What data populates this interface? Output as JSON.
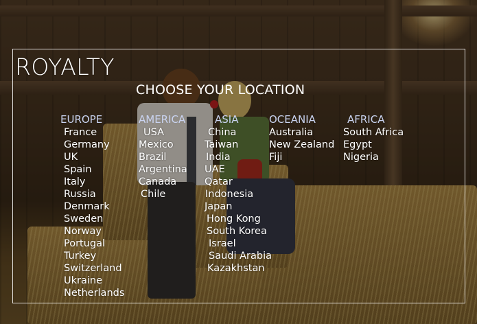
{
  "brand": "ROYALTY",
  "heading": "CHOOSE YOUR LOCATION",
  "regions": [
    {
      "title": "EUROPE",
      "countries": [
        "France",
        "Germany",
        "UK",
        "Spain",
        "Italy",
        "Russia",
        "Denmark",
        "Sweden",
        "Norway",
        "Portugal",
        "Turkey",
        "Switzerland",
        "Ukraine",
        "Netherlands"
      ]
    },
    {
      "title": "AMERICA",
      "countries": [
        "USA",
        "Mexico",
        "Brazil",
        "Argentina",
        "Canada",
        "Chile"
      ]
    },
    {
      "title": "ASIA",
      "countries": [
        "China",
        "Taiwan",
        "India",
        "UAE",
        "Qatar",
        "Indonesia",
        "Japan",
        "Hong Kong",
        "South Korea",
        "Israel",
        "Saudi Arabia",
        "Kazakhstan"
      ]
    },
    {
      "title": "OCEANIA",
      "countries": [
        "Australia",
        "New Zealand",
        "Fiji"
      ]
    },
    {
      "title": "AFRICA",
      "countries": [
        "South Africa",
        "Egypt",
        "Nigeria"
      ]
    }
  ],
  "colors": {
    "text": "#ffffff",
    "region_title": "#c9d3f0",
    "frame": "#ffffff"
  }
}
